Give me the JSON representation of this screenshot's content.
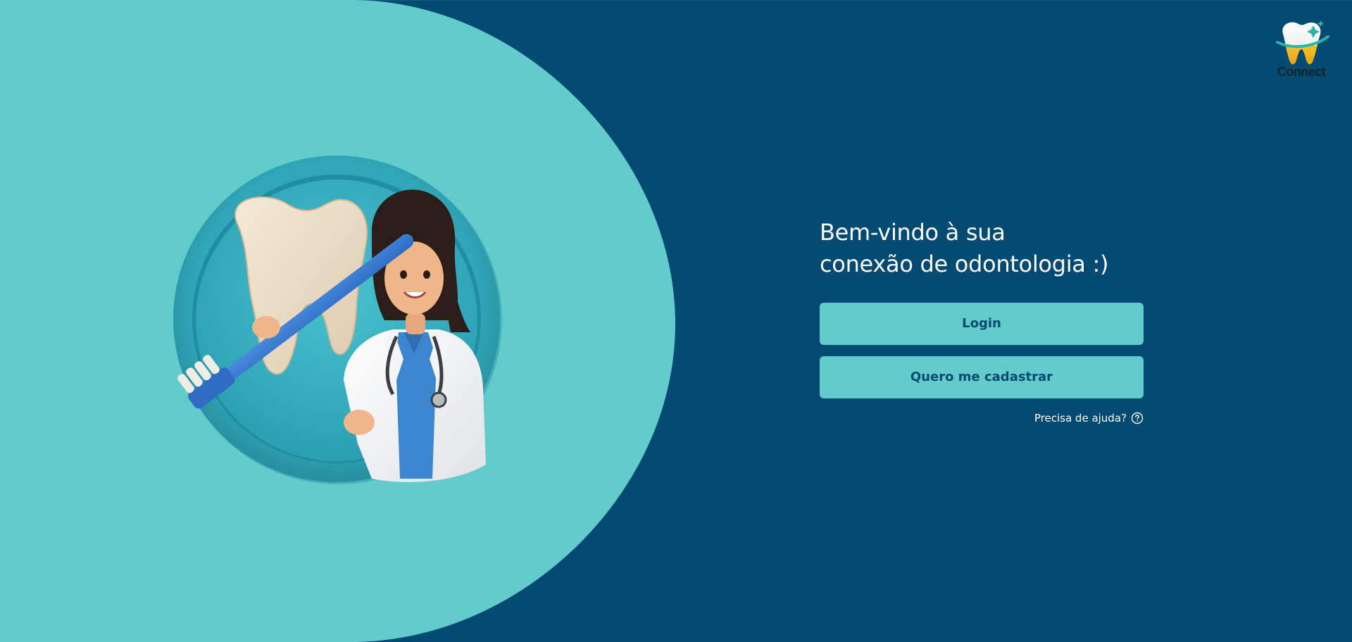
{
  "brand": {
    "logo_text": "Connect",
    "logo_icon": "tooth-icon"
  },
  "welcome": {
    "line1": "Bem-vindo à sua",
    "line2": "conexão de odontologia :)"
  },
  "actions": {
    "login_label": "Login",
    "signup_label": "Quero me cadastrar"
  },
  "help": {
    "label": "Precisa de ajuda?",
    "icon": "question-circle-icon"
  },
  "illustration": {
    "icon": "dentist-with-tooth-and-toothbrush-illustration"
  },
  "colors": {
    "background": "#034a73",
    "accent": "#62cbcb",
    "button_text": "#034a73",
    "text": "#ffffff"
  }
}
